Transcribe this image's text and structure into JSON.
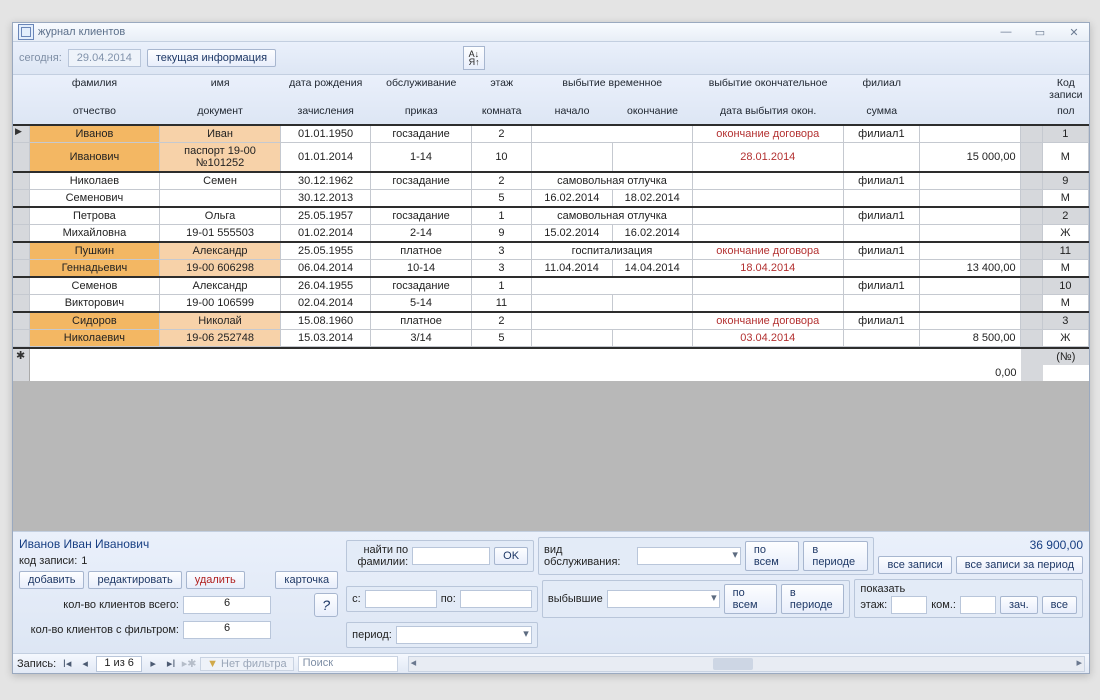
{
  "window": {
    "title": "журнал клиентов"
  },
  "toolbar": {
    "today_label": "сегодня:",
    "today_date": "29.04.2014",
    "current_info": "текущая информация"
  },
  "columns": {
    "r1": [
      "фамилия",
      "имя",
      "дата рождения",
      "обслуживание",
      "этаж",
      "выбытие временное",
      "",
      "выбытие окончательное",
      "филиал",
      "",
      "Код записи"
    ],
    "r2": [
      "отчество",
      "документ",
      "зачисления",
      "приказ",
      "комната",
      "начало",
      "окончание",
      "дата выбытия окон.",
      "сумма",
      "",
      "пол"
    ],
    "absent_merge": "выбытие временное"
  },
  "records": [
    {
      "highlight": true,
      "surname": "Иванов",
      "name": "Иван",
      "dob": "01.01.1950",
      "service": "госзадание",
      "floor": "2",
      "temp_kind": "",
      "final_kind": "окончание договора",
      "branch": "филиал1",
      "rec_id": "1",
      "patronym": "Иванович",
      "document": "паспорт 19-00 №101252",
      "enroll": "01.01.2014",
      "order": "1-14",
      "room": "10",
      "temp_start": "",
      "temp_end": "",
      "final_date": "28.01.2014",
      "amount": "15 000,00",
      "sex": "М"
    },
    {
      "highlight": false,
      "surname": "Николаев",
      "name": "Семен",
      "dob": "30.12.1962",
      "service": "госзадание",
      "floor": "2",
      "temp_kind": "самовольная отлучка",
      "final_kind": "",
      "branch": "филиал1",
      "rec_id": "9",
      "patronym": "Семенович",
      "document": "",
      "enroll": "30.12.2013",
      "order": "",
      "room": "5",
      "temp_start": "16.02.2014",
      "temp_end": "18.02.2014",
      "final_date": "",
      "amount": "",
      "sex": "М"
    },
    {
      "highlight": false,
      "surname": "Петрова",
      "name": "Ольга",
      "dob": "25.05.1957",
      "service": "госзадание",
      "floor": "1",
      "temp_kind": "самовольная отлучка",
      "final_kind": "",
      "branch": "филиал1",
      "rec_id": "2",
      "patronym": "Михайловна",
      "document": "19-01 555503",
      "enroll": "01.02.2014",
      "order": "2-14",
      "room": "9",
      "temp_start": "15.02.2014",
      "temp_end": "16.02.2014",
      "final_date": "",
      "amount": "",
      "sex": "Ж"
    },
    {
      "highlight": true,
      "surname": "Пушкин",
      "name": "Александр",
      "dob": "25.05.1955",
      "service": "платное",
      "floor": "3",
      "temp_kind": "госпитализация",
      "final_kind": "окончание договора",
      "branch": "филиал1",
      "rec_id": "11",
      "patronym": "Геннадьевич",
      "document": "19-00 606298",
      "enroll": "06.04.2014",
      "order": "10-14",
      "room": "3",
      "temp_start": "11.04.2014",
      "temp_end": "14.04.2014",
      "final_date": "18.04.2014",
      "amount": "13 400,00",
      "sex": "М"
    },
    {
      "highlight": false,
      "surname": "Семенов",
      "name": "Александр",
      "dob": "26.04.1955",
      "service": "госзадание",
      "floor": "1",
      "temp_kind": "",
      "final_kind": "",
      "branch": "филиал1",
      "rec_id": "10",
      "patronym": "Викторович",
      "document": "19-00 106599",
      "enroll": "02.04.2014",
      "order": "5-14",
      "room": "11",
      "temp_start": "",
      "temp_end": "",
      "final_date": "",
      "amount": "",
      "sex": "М"
    },
    {
      "highlight": true,
      "surname": "Сидоров",
      "name": "Николай",
      "dob": "15.08.1960",
      "service": "платное",
      "floor": "2",
      "temp_kind": "",
      "final_kind": "окончание договора",
      "branch": "филиал1",
      "rec_id": "3",
      "patronym": "Николаевич",
      "document": "19-06 252748",
      "enroll": "15.03.2014",
      "order": "3/14",
      "room": "5",
      "temp_start": "",
      "temp_end": "",
      "final_date": "03.04.2014",
      "amount": "8 500,00",
      "sex": "Ж"
    }
  ],
  "newrow": {
    "amount": "0,00",
    "rec_marker": "(№)"
  },
  "footer": {
    "selected_name": "Иванов Иван Иванович",
    "code_label": "код записи:",
    "code_value": "1",
    "add": "добавить",
    "edit": "редактировать",
    "delete": "удалить",
    "card": "карточка",
    "count_total_label": "кол-во клиентов всего:",
    "count_total": "6",
    "count_filter_label": "кол-во клиентов с фильтром:",
    "count_filter": "6",
    "find_label": "найти по фамилии:",
    "ok": "OK",
    "service_label": "вид обслуживания:",
    "by_all": "по всем",
    "in_period": "в периоде",
    "all_records": "все записи",
    "all_records_period": "все записи за период",
    "from": "с:",
    "to": "по:",
    "period": "период:",
    "departed": "выбывшие",
    "show": "показать",
    "floor": "этаж:",
    "room": "ком.:",
    "enroll": "зач.",
    "all": "все",
    "total": "36 900,00"
  },
  "status": {
    "label": "Запись:",
    "pos": "1 из 6",
    "no_filter": "Нет фильтра",
    "search": "Поиск"
  }
}
